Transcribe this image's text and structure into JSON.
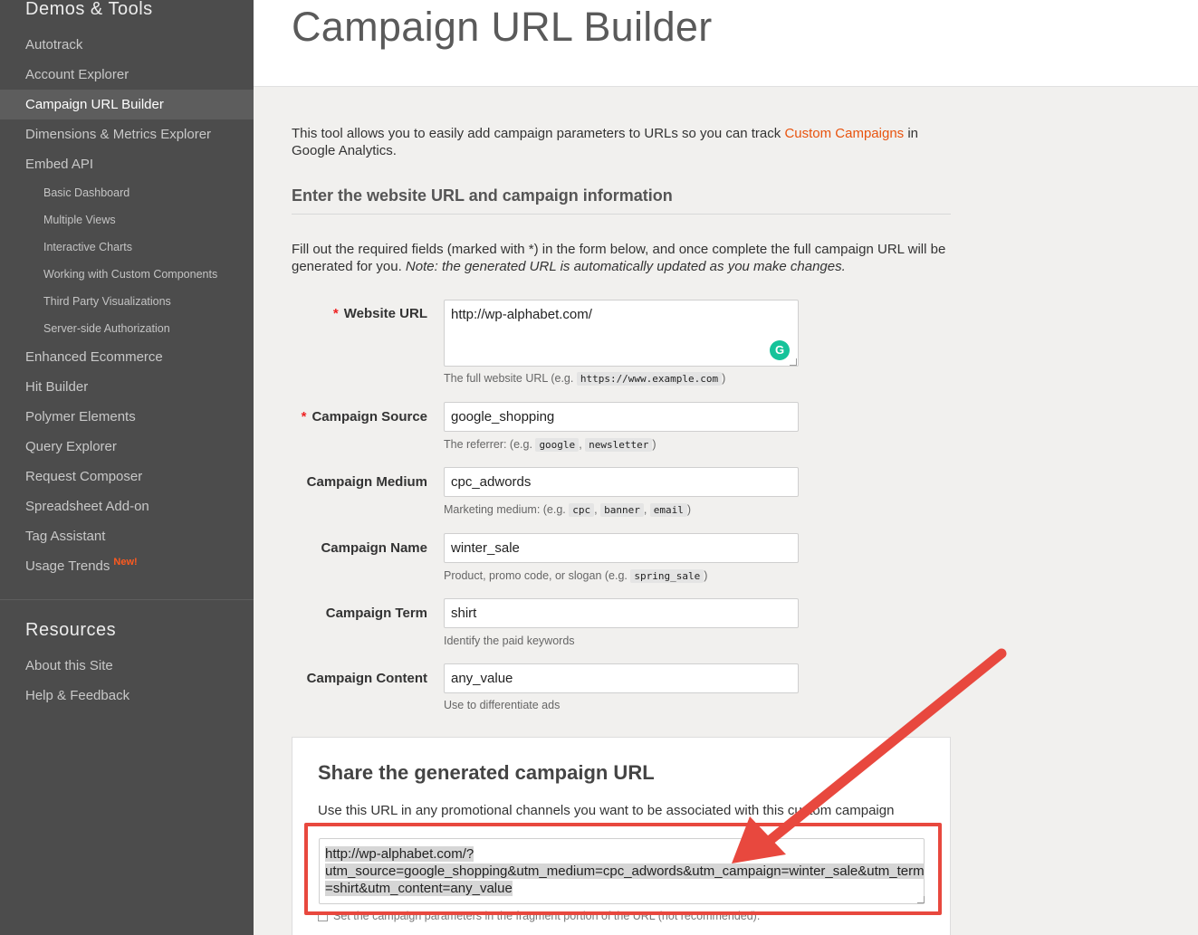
{
  "sidebar": {
    "section1_title": "Demos & Tools",
    "items": [
      {
        "label": "Autotrack"
      },
      {
        "label": "Account Explorer"
      },
      {
        "label": "Campaign URL Builder"
      },
      {
        "label": "Dimensions & Metrics Explorer"
      },
      {
        "label": "Embed API"
      }
    ],
    "sub_items": [
      {
        "label": "Basic Dashboard"
      },
      {
        "label": "Multiple Views"
      },
      {
        "label": "Interactive Charts"
      },
      {
        "label": "Working with Custom Components"
      },
      {
        "label": "Third Party Visualizations"
      },
      {
        "label": "Server-side Authorization"
      }
    ],
    "items2": [
      {
        "label": "Enhanced Ecommerce"
      },
      {
        "label": "Hit Builder"
      },
      {
        "label": "Polymer Elements"
      },
      {
        "label": "Query Explorer"
      },
      {
        "label": "Request Composer"
      },
      {
        "label": "Spreadsheet Add-on"
      },
      {
        "label": "Tag Assistant"
      },
      {
        "label": "Usage Trends",
        "badge": "New!"
      }
    ],
    "section2_title": "Resources",
    "resources": [
      {
        "label": "About this Site"
      },
      {
        "label": "Help & Feedback"
      }
    ]
  },
  "page": {
    "title": "Campaign URL Builder",
    "intro_before": "This tool allows you to easily add campaign parameters to URLs so you can track ",
    "intro_link": "Custom Campaigns",
    "intro_after": " in Google Analytics.",
    "section_title": "Enter the website URL and campaign information",
    "instructions": "Fill out the required fields (marked with *) in the form below, and once complete the full campaign URL will be generated for you. ",
    "instructions_note": "Note: the generated URL is automatically updated as you make changes."
  },
  "form": {
    "required_mark": "*",
    "website_url": {
      "label": "Website URL",
      "value": "http://wp-alphabet.com/",
      "help_prefix": "The full website URL (e.g. ",
      "help_code": "https://www.example.com",
      "help_suffix": ")"
    },
    "source": {
      "label": "Campaign Source",
      "value": "google_shopping",
      "help_prefix": "The referrer: (e.g. ",
      "codes": [
        "google",
        "newsletter"
      ],
      "help_suffix": ")"
    },
    "medium": {
      "label": "Campaign Medium",
      "value": "cpc_adwords",
      "help_prefix": "Marketing medium: (e.g. ",
      "codes": [
        "cpc",
        "banner",
        "email"
      ],
      "help_suffix": ")"
    },
    "name": {
      "label": "Campaign Name",
      "value": "winter_sale",
      "help_prefix": "Product, promo code, or slogan (e.g. ",
      "help_code": "spring_sale",
      "help_suffix": ")"
    },
    "term": {
      "label": "Campaign Term",
      "value": "shirt",
      "help": "Identify the paid keywords"
    },
    "content": {
      "label": "Campaign Content",
      "value": "any_value",
      "help": "Use to differentiate ads"
    }
  },
  "share": {
    "title": "Share the generated campaign URL",
    "description": "Use this URL in any promotional channels you want to be associated with this custom campaign",
    "url_line1": "http://wp-alphabet.com/?",
    "url_line2": "utm_source=google_shopping&utm_medium=cpc_adwords&utm_campaign=winter_sale&utm_term",
    "url_line3": "=shirt&utm_content=any_value",
    "fragment_option": "Set the campaign parameters in the fragment portion of the URL (not recommended)."
  },
  "colors": {
    "sidebar_bg": "#4c4c4c",
    "link_accent": "#e8530e",
    "annotation_red": "#e8483e",
    "required_star": "#e22"
  },
  "icons": {
    "grammarly": "grammarly-icon"
  }
}
